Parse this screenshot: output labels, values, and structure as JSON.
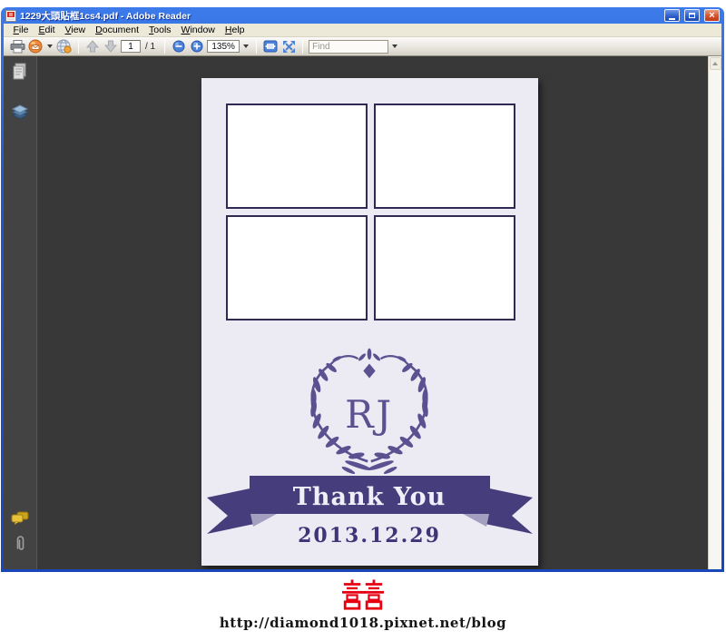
{
  "window": {
    "title": "1229大頭貼框1cs4.pdf - Adobe Reader",
    "close_glyph": "×"
  },
  "menu": {
    "items": [
      "File",
      "Edit",
      "View",
      "Document",
      "Tools",
      "Window",
      "Help"
    ]
  },
  "toolbar": {
    "page_current": "1",
    "page_total": "/ 1",
    "zoom_level": "135%",
    "find_placeholder": "Find"
  },
  "sidebar_icons": [
    "pages-icon",
    "layers-icon",
    "comments-icon",
    "attachments-icon"
  ],
  "toolbar_icons": [
    "print-icon",
    "email-icon",
    "collaborate-icon",
    "previous-page-icon",
    "next-page-icon",
    "zoom-out-icon",
    "zoom-in-icon",
    "fit-width-icon",
    "fullscreen-icon"
  ],
  "document_page": {
    "photo_slot_count": 4,
    "monogram": "RJ",
    "banner_text": "Thank You",
    "date": "2013.12.29"
  },
  "footer": {
    "symbol": "囍",
    "symbol_meaning": "double-happiness",
    "url": "http://diamond1018.pixnet.net/blog"
  },
  "colors": {
    "wreath_purple": "#5b5191",
    "ribbon_purple": "#463d7c",
    "date_purple": "#3d3578",
    "fold_gray": "#a29fc0",
    "page_bg": "#eceaf3",
    "frame_border": "#2f2b52",
    "happiness_red": "#e60012",
    "doc_area_bg": "#383838",
    "titlebar_blue": "#2058d4"
  }
}
